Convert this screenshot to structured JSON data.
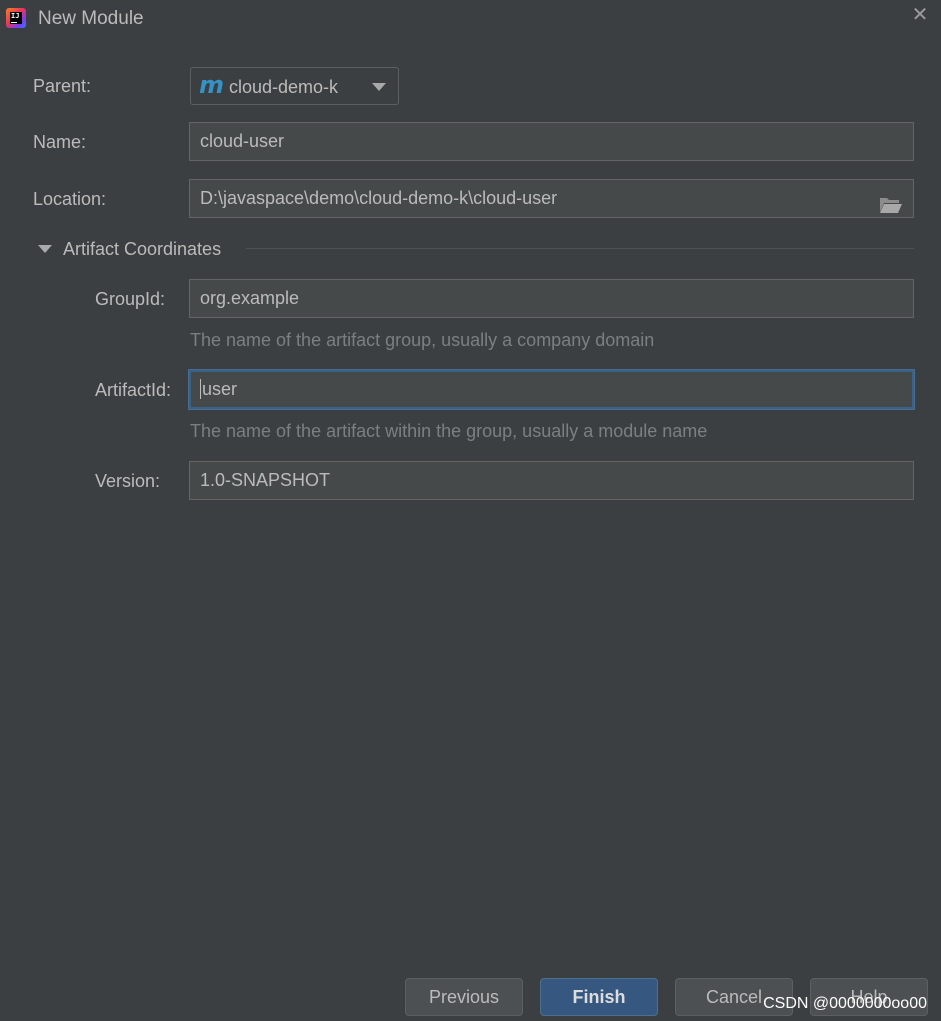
{
  "window": {
    "title": "New Module",
    "close_glyph": "✕"
  },
  "form": {
    "parent_label": "Parent:",
    "parent_value": "cloud-demo-k",
    "parent_icon_glyph": "m",
    "name_label": "Name:",
    "name_value": "cloud-user",
    "location_label": "Location:",
    "location_value": "D:\\javaspace\\demo\\cloud-demo-k\\cloud-user"
  },
  "artifact": {
    "section_title": "Artifact Coordinates",
    "groupid_label": "GroupId:",
    "groupid_value": "org.example",
    "groupid_hint": "The name of the artifact group, usually a company domain",
    "artifactid_label": "ArtifactId:",
    "artifactid_value": "user",
    "artifactid_hint": "The name of the artifact within the group, usually a module name",
    "version_label": "Version:",
    "version_value": "1.0-SNAPSHOT"
  },
  "buttons": {
    "previous": "Previous",
    "finish": "Finish",
    "cancel": "Cancel",
    "help": "Help"
  },
  "watermark": "CSDN @0000000oo00",
  "colors": {
    "background": "#3c3f41",
    "field_bg": "#45494a",
    "primary_button": "#365880",
    "maven_icon": "#3592c4",
    "focus_border": "#3d6185"
  }
}
